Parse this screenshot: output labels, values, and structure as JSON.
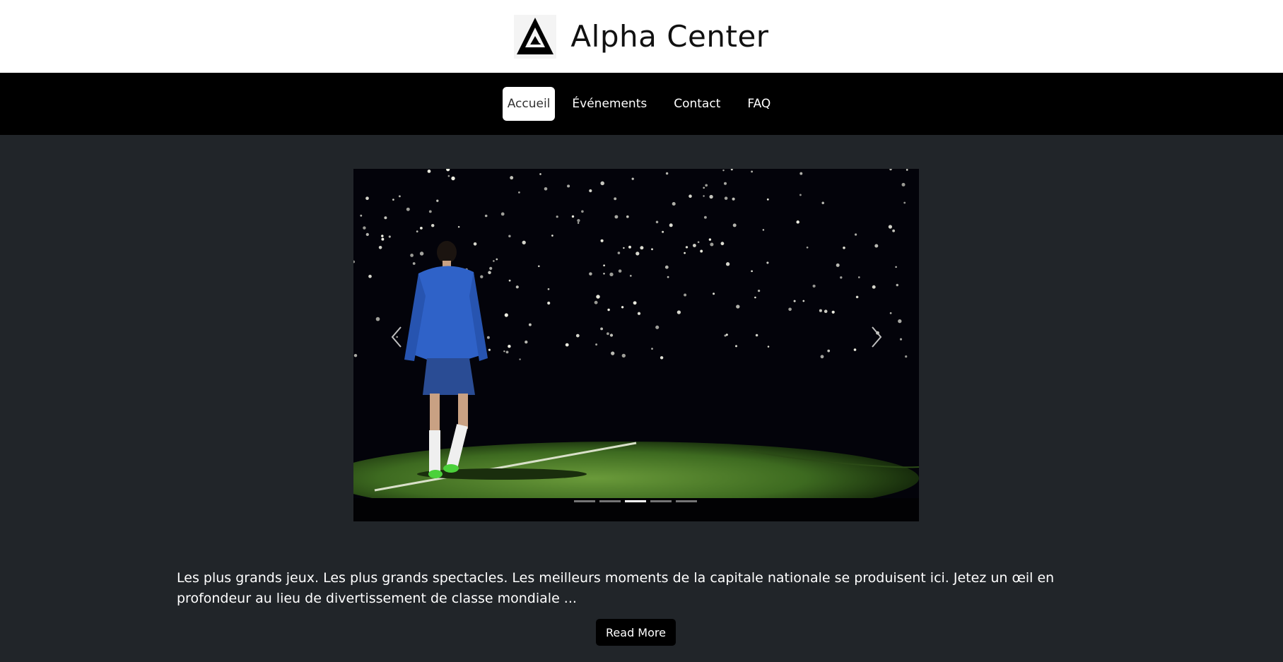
{
  "site": {
    "title": "Alpha Center",
    "logo_icon": "alpha-triangle-logo-icon"
  },
  "nav": {
    "items": [
      {
        "label": "Accueil",
        "active": true
      },
      {
        "label": "Événements",
        "active": false
      },
      {
        "label": "Contact",
        "active": false
      },
      {
        "label": "FAQ",
        "active": false
      }
    ]
  },
  "carousel": {
    "prev_icon": "chevron-left-icon",
    "next_icon": "chevron-right-icon",
    "indicator_count": 5,
    "active_index": 2
  },
  "intro": {
    "text": "Les plus grands jeux. Les plus grands spectacles. Les meilleurs moments de la capitale nationale se produisent ici. Jetez un œil en profondeur au lieu de divertissement de classe mondiale ..."
  },
  "cta": {
    "read_more_label": "Read More"
  },
  "colors": {
    "page_bg": "#212529",
    "nav_bg": "#000000",
    "header_bg": "#ffffff"
  }
}
